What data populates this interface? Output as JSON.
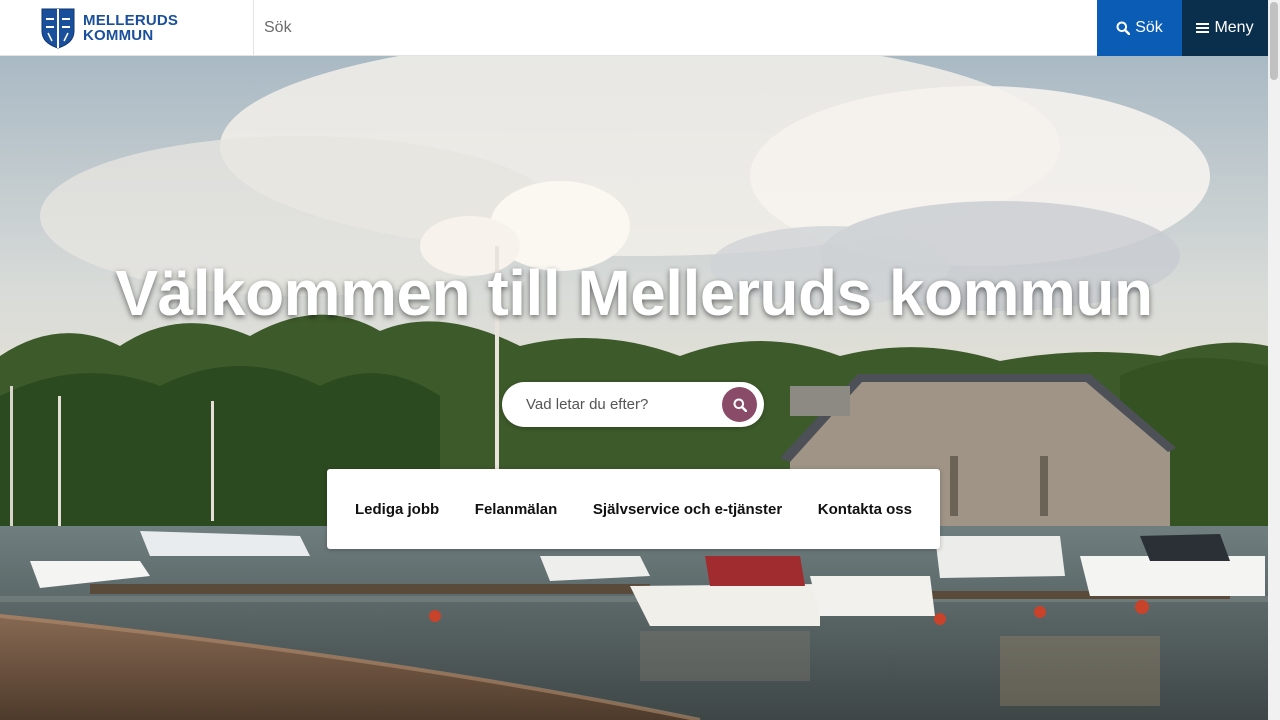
{
  "header": {
    "logo_line1": "MELLERUDS",
    "logo_line2": "KOMMUN",
    "search_placeholder": "Sök",
    "search_button_label": "Sök",
    "menu_button_label": "Meny"
  },
  "hero": {
    "title": "Välkommen till Melleruds kommun",
    "search_placeholder": "Vad letar du efter?"
  },
  "quick_links": [
    {
      "label": "Lediga jobb"
    },
    {
      "label": "Felanmälan"
    },
    {
      "label": "Självservice och e-tjänster"
    },
    {
      "label": "Kontakta oss"
    }
  ],
  "colors": {
    "brand_blue": "#0a5cb4",
    "menu_dark": "#0a2f4d",
    "search_accent": "#8a4b68"
  }
}
